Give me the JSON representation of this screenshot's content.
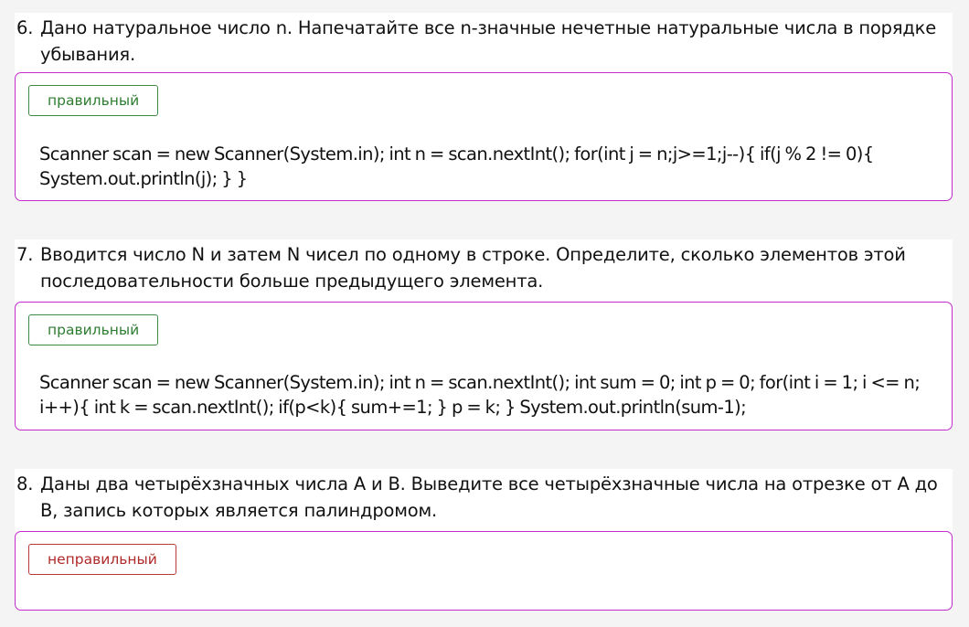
{
  "questions": [
    {
      "number": "6.",
      "text": "Дано натуральное число n. Напечатайте все n-значные нечетные натуральные числа в порядке убывания.",
      "status_label": "правильный",
      "status": "correct",
      "answer": "Scanner scan = new Scanner(System.in); int n = scan.nextInt(); for(int j = n;j>=1;j--){ if(j % 2 != 0){ System.out.println(j); } }"
    },
    {
      "number": "7.",
      "text": "Вводится число N и затем N чисел по одному в строке. Определите, сколько элементов этой последовательности больше предыдущего элемента.",
      "status_label": "правильный",
      "status": "correct",
      "answer": "Scanner scan = new Scanner(System.in); int n = scan.nextInt(); int sum = 0; int p = 0; for(int i = 1; i <= n; i++){ int k = scan.nextInt(); if(p<k){ sum+=1; } p = k; } System.out.println(sum-1);"
    },
    {
      "number": "8.",
      "text": "Даны два четырёхзначных числа A и B. Выведите все четырёхзначные числа на отрезке от A до B, запись которых является палиндромом.",
      "status_label": "неправильный",
      "status": "wrong",
      "answer": ""
    }
  ],
  "colors": {
    "card_border": "#c32bcf",
    "correct": "#2e7d32",
    "wrong": "#b02a2a"
  }
}
